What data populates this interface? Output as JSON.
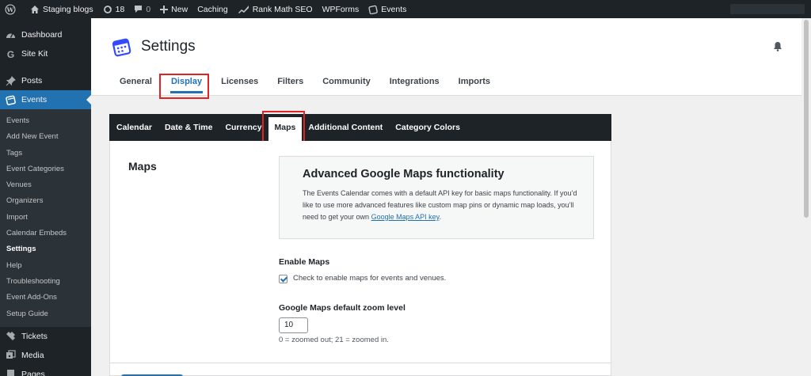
{
  "adminbar": {
    "site_name": "Staging blogs",
    "updates_count": "18",
    "comments_count": "0",
    "new_label": "New",
    "caching_label": "Caching",
    "rankmath_label": "Rank Math SEO",
    "wpforms_label": "WPForms",
    "events_label": "Events"
  },
  "sidebar": {
    "top_items": [
      "Dashboard",
      "Site Kit",
      "Posts",
      "Events"
    ],
    "sub_items": [
      "Events",
      "Add New Event",
      "Tags",
      "Event Categories",
      "Venues",
      "Organizers",
      "Import",
      "Calendar Embeds",
      "Settings",
      "Help",
      "Troubleshooting",
      "Event Add-Ons",
      "Setup Guide"
    ],
    "bottom_items": [
      "Tickets",
      "Media",
      "Pages"
    ]
  },
  "header": {
    "title": "Settings",
    "tabs": [
      "General",
      "Display",
      "Licenses",
      "Filters",
      "Community",
      "Integrations",
      "Imports"
    ]
  },
  "subtabs": [
    "Calendar",
    "Date & Time",
    "Currency",
    "Maps",
    "Additional Content",
    "Category Colors"
  ],
  "maps": {
    "section_title": "Maps",
    "info_title": "Advanced Google Maps functionality",
    "info_text": "The Events Calendar comes with a default API key for basic maps functionality. If you’d like to use more advanced features like custom map pins or dynamic map loads, you’ll need to get your own ",
    "info_link": "Google Maps API key",
    "info_suffix": ".",
    "enable_label": "Enable Maps",
    "enable_checked": true,
    "enable_help": "Check to enable maps for events and venues.",
    "zoom_label": "Google Maps default zoom level",
    "zoom_value": "10",
    "zoom_help": "0 = zoomed out; 21 = zoomed in."
  },
  "colors": {
    "admin_dark": "#1d2327",
    "accent": "#2271b1",
    "highlight_red": "#e02424"
  }
}
